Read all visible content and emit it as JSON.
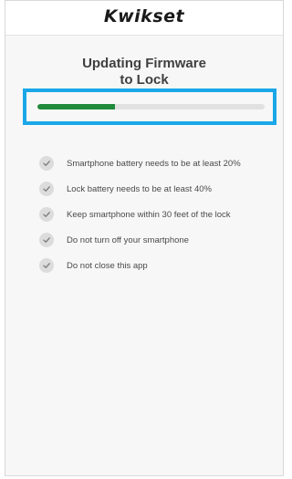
{
  "header": {
    "logo_text": "Kwikset"
  },
  "page": {
    "title_line1": "Updating Firmware",
    "title_line2": "to Lock"
  },
  "progress": {
    "fraction": 0.34,
    "track_color": "#e1e1e1",
    "fill_color": "#1f8a3b",
    "highlight_color": "#1aa7e8"
  },
  "checklist": [
    {
      "icon": "checkmark-icon",
      "label": "Smartphone battery needs to be at least 20%"
    },
    {
      "icon": "checkmark-icon",
      "label": "Lock battery needs to be at least 40%"
    },
    {
      "icon": "checkmark-icon",
      "label": "Keep smartphone within 30 feet of the lock"
    },
    {
      "icon": "checkmark-icon",
      "label": "Do not turn off your smartphone"
    },
    {
      "icon": "checkmark-icon",
      "label": "Do not close this app"
    }
  ]
}
